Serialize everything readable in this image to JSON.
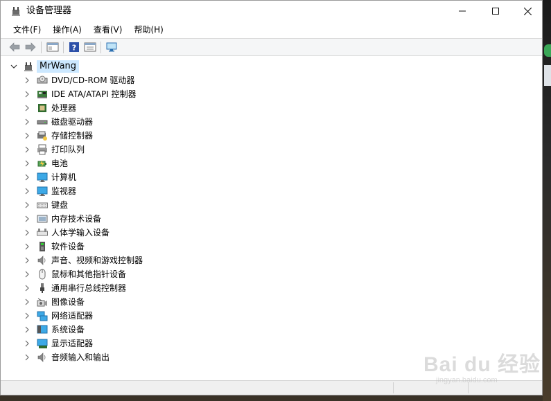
{
  "window": {
    "title": "设备管理器",
    "controls": {
      "minimize": "—",
      "maximize": "☐",
      "close": "✕"
    }
  },
  "menu": [
    "文件(F)",
    "操作(A)",
    "查看(V)",
    "帮助(H)"
  ],
  "toolbar": {
    "icons": [
      "back-arrow-icon",
      "forward-arrow-icon",
      "show-hide-console-tree-icon",
      "help-icon",
      "properties-icon",
      "scan-hardware-icon"
    ]
  },
  "tree": {
    "root": "MrWang",
    "items": [
      {
        "label": "DVD/CD-ROM 驱动器",
        "icon": "dvd-drive-icon"
      },
      {
        "label": "IDE ATA/ATAPI 控制器",
        "icon": "ide-controller-icon"
      },
      {
        "label": "处理器",
        "icon": "processor-icon"
      },
      {
        "label": "磁盘驱动器",
        "icon": "disk-drive-icon"
      },
      {
        "label": "存储控制器",
        "icon": "storage-controller-icon"
      },
      {
        "label": "打印队列",
        "icon": "printer-icon"
      },
      {
        "label": "电池",
        "icon": "battery-icon"
      },
      {
        "label": "计算机",
        "icon": "computer-icon"
      },
      {
        "label": "监视器",
        "icon": "monitor-icon"
      },
      {
        "label": "键盘",
        "icon": "keyboard-icon"
      },
      {
        "label": "内存技术设备",
        "icon": "memory-device-icon"
      },
      {
        "label": "人体学输入设备",
        "icon": "hid-icon"
      },
      {
        "label": "软件设备",
        "icon": "software-device-icon"
      },
      {
        "label": "声音、视频和游戏控制器",
        "icon": "speaker-icon"
      },
      {
        "label": "鼠标和其他指针设备",
        "icon": "mouse-icon"
      },
      {
        "label": "通用串行总线控制器",
        "icon": "usb-icon"
      },
      {
        "label": "图像设备",
        "icon": "camera-icon"
      },
      {
        "label": "网络适配器",
        "icon": "network-adapter-icon"
      },
      {
        "label": "系统设备",
        "icon": "system-device-icon"
      },
      {
        "label": "显示适配器",
        "icon": "display-adapter-icon"
      },
      {
        "label": "音频输入和输出",
        "icon": "audio-io-icon"
      }
    ]
  },
  "watermark": {
    "main": "Bai du 经验",
    "sub": "jingyan.baidu.com"
  },
  "colors": {
    "selection": "#cce8ff",
    "toolbar_bg": "#f5f6f7",
    "status_bg": "#f0f0f0"
  }
}
